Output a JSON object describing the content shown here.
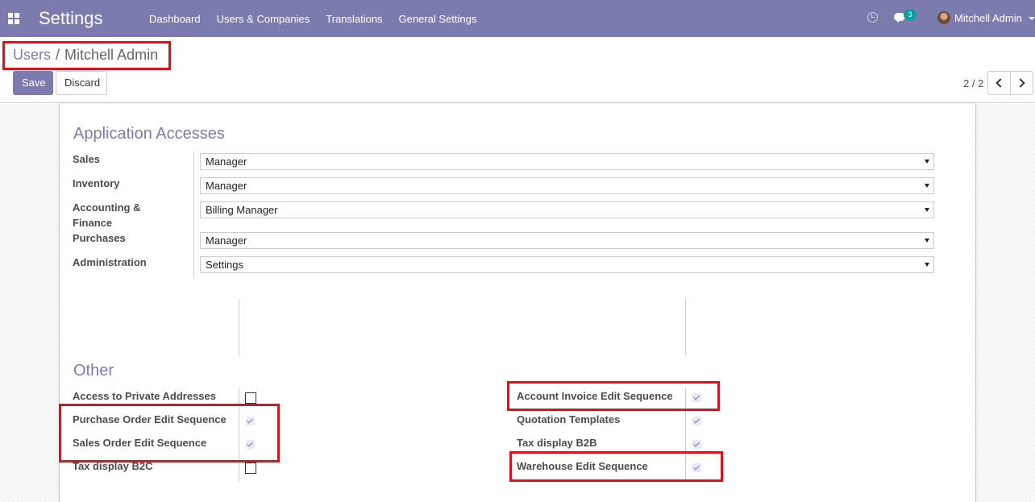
{
  "navbar": {
    "app_title": "Settings",
    "menu": [
      "Dashboard",
      "Users & Companies",
      "Translations",
      "General Settings"
    ],
    "message_count": "3",
    "user_name": "Mitchell Admin",
    "bg_color": "#7c7bad"
  },
  "breadcrumb": {
    "parent": "Users",
    "separator": "/",
    "current": "Mitchell Admin"
  },
  "buttons": {
    "save": "Save",
    "discard": "Discard"
  },
  "pager": {
    "value": "2 / 2"
  },
  "application_accesses": {
    "title": "Application Accesses",
    "fields": [
      {
        "label": "Sales",
        "value": "Manager"
      },
      {
        "label": "Inventory",
        "value": "Manager"
      },
      {
        "label": "Accounting &\nFinance",
        "value": "Billing Manager"
      },
      {
        "label": "Purchases",
        "value": "Manager"
      },
      {
        "label": "Administration",
        "value": "Settings"
      }
    ]
  },
  "other": {
    "title": "Other",
    "left": [
      {
        "label": "Access to Private Addresses",
        "checked": false
      },
      {
        "label": "Purchase Order Edit Sequence",
        "checked": true
      },
      {
        "label": "Sales Order Edit Sequence",
        "checked": true
      },
      {
        "label": "Tax display B2C",
        "checked": false
      }
    ],
    "right": [
      {
        "label": "Account Invoice Edit Sequence",
        "checked": true
      },
      {
        "label": "Quotation Templates",
        "checked": true
      },
      {
        "label": "Tax display B2B",
        "checked": true
      },
      {
        "label": "Warehouse Edit Sequence",
        "checked": true
      }
    ]
  },
  "colors": {
    "accent": "#7c7bad",
    "highlight": "#e0101a",
    "badge": "#00a09d"
  }
}
